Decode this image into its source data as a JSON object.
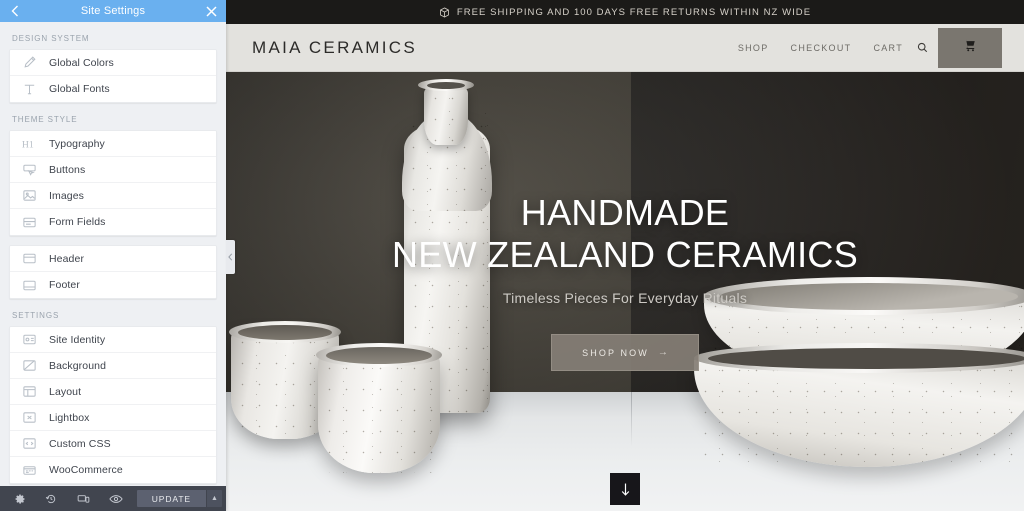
{
  "panel": {
    "title": "Site Settings",
    "back_icon": "chevron-left-icon",
    "close_icon": "close-icon",
    "accent_color": "#6ab0ef",
    "sections": [
      {
        "title": "DESIGN SYSTEM",
        "groups": [
          {
            "items": [
              {
                "label": "Global Colors",
                "icon": "brush-icon"
              },
              {
                "label": "Global Fonts",
                "icon": "text-type-icon"
              }
            ]
          }
        ]
      },
      {
        "title": "THEME STYLE",
        "groups": [
          {
            "items": [
              {
                "label": "Typography",
                "icon": "heading-h1-icon"
              },
              {
                "label": "Buttons",
                "icon": "button-click-icon"
              },
              {
                "label": "Images",
                "icon": "image-icon"
              },
              {
                "label": "Form Fields",
                "icon": "form-field-icon"
              }
            ]
          },
          {
            "items": [
              {
                "label": "Header",
                "icon": "header-layout-icon"
              },
              {
                "label": "Footer",
                "icon": "footer-layout-icon"
              }
            ]
          }
        ]
      },
      {
        "title": "SETTINGS",
        "groups": [
          {
            "items": [
              {
                "label": "Site Identity",
                "icon": "id-card-icon"
              },
              {
                "label": "Background",
                "icon": "background-icon"
              },
              {
                "label": "Layout",
                "icon": "layout-grid-icon"
              },
              {
                "label": "Lightbox",
                "icon": "lightbox-icon"
              },
              {
                "label": "Custom CSS",
                "icon": "code-brackets-icon"
              },
              {
                "label": "WooCommerce",
                "icon": "woocommerce-icon"
              }
            ]
          }
        ]
      }
    ],
    "footer": {
      "icons": [
        {
          "name": "settings-gear-icon"
        },
        {
          "name": "history-revisions-icon"
        },
        {
          "name": "responsive-preview-icon"
        },
        {
          "name": "preview-eye-icon"
        }
      ],
      "update_label": "UPDATE",
      "update_caret": "▲",
      "bar_color": "#41454f"
    },
    "collapse_handle_icon": "chevron-left-icon"
  },
  "preview": {
    "announcement": {
      "icon": "package-box-icon",
      "text": "FREE SHIPPING AND 100 DAYS FREE RETURNS WITHIN NZ WIDE",
      "bg_color": "#1b1a18"
    },
    "header": {
      "logo": "MAIA CERAMICS",
      "bg_color": "#e3e2de",
      "nav": [
        {
          "label": "SHOP"
        },
        {
          "label": "CHECKOUT"
        },
        {
          "label": "CART"
        }
      ],
      "search_icon": "search-icon",
      "cart_icon": "shopping-cart-icon",
      "cart_button_color": "#7a766f"
    },
    "hero": {
      "title_line1": "HANDMADE",
      "title_line2": "NEW ZEALAND CERAMICS",
      "subtitle": "Timeless Pieces For Everyday Rituals",
      "cta_label": "SHOP NOW",
      "cta_arrow": "→",
      "cta_color": "#847e75",
      "scroll_icon": "arrow-down-icon"
    }
  }
}
